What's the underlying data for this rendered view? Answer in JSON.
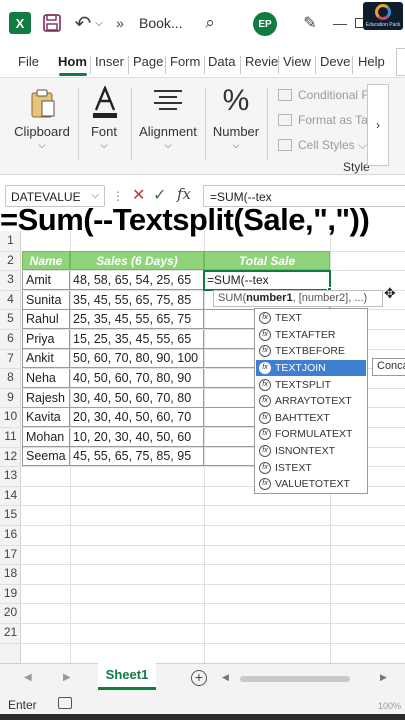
{
  "titlebar": {
    "book_name": "Book...",
    "more": "»",
    "avatar_initials": "EP",
    "brand_text": "Education Pack",
    "colors": {
      "excel_green": "#107c41"
    }
  },
  "tabs": [
    "File",
    "Hom",
    "Inser",
    "Page",
    "Form",
    "Data",
    "Revie",
    "View",
    "Deve",
    "Help"
  ],
  "ribbon": {
    "groups": [
      {
        "label": "Clipboard",
        "icon": "clipboard-icon"
      },
      {
        "label": "Font",
        "icon": "font-color-icon"
      },
      {
        "label": "Alignment",
        "icon": "align-lines-icon"
      },
      {
        "label": "Number",
        "icon": "percent-icon"
      }
    ],
    "styles_items": [
      "Conditional F",
      "Format as Tal",
      "Cell Styles"
    ],
    "styles_label": "Style"
  },
  "formula_bar": {
    "name_box": "DATEVALUE",
    "formula": "=SUM(--tex"
  },
  "caption": "=Sum(--Textsplit(Sale,\",\"))",
  "grid": {
    "row_numbers": [
      "1",
      "2",
      "3",
      "4",
      "5",
      "6",
      "7",
      "8",
      "9",
      "10",
      "11",
      "12",
      "13",
      "14",
      "15",
      "16",
      "17",
      "18",
      "19",
      "20",
      "21"
    ],
    "headers": {
      "name": "Name",
      "sales": "Sales (6 Days)",
      "total": "Total Sale"
    },
    "rows": [
      {
        "name": "Amit",
        "sales": "48, 58, 65, 54, 25, 65"
      },
      {
        "name": "Sunita",
        "sales": "35, 45, 55, 65, 75, 85"
      },
      {
        "name": "Rahul",
        "sales": "25, 35, 45, 55, 65, 75"
      },
      {
        "name": "Priya",
        "sales": "15, 25, 35, 45, 55, 65"
      },
      {
        "name": "Ankit",
        "sales": "50, 60, 70, 80, 90, 100"
      },
      {
        "name": "Neha",
        "sales": "40, 50, 60, 70, 80, 90"
      },
      {
        "name": "Rajesh",
        "sales": "30, 40, 50, 60, 70, 80"
      },
      {
        "name": "Kavita",
        "sales": "20, 30, 40, 50, 60, 70"
      },
      {
        "name": "Mohan",
        "sales": "10, 20, 30, 40, 50, 60"
      },
      {
        "name": "Seema",
        "sales": "45, 55, 65, 75, 85, 95"
      }
    ],
    "active_cell_text": "=SUM(--tex",
    "header_color": "#8fd37a"
  },
  "tooltip": {
    "prefix": "SUM(",
    "arg1": "number1",
    "rest": ", [number2], ...)"
  },
  "autocomplete": {
    "items": [
      "TEXT",
      "TEXTAFTER",
      "TEXTBEFORE",
      "TEXTJOIN",
      "TEXTSPLIT",
      "ARRAYTOTEXT",
      "BAHTTEXT",
      "FORMULATEXT",
      "ISNONTEXT",
      "ISTEXT",
      "VALUETOTEXT"
    ],
    "selected": "TEXTJOIN",
    "side_tip": "Conca"
  },
  "sheets": {
    "active": "Sheet1"
  },
  "status": {
    "mode": "Enter",
    "zoom": "100%"
  }
}
